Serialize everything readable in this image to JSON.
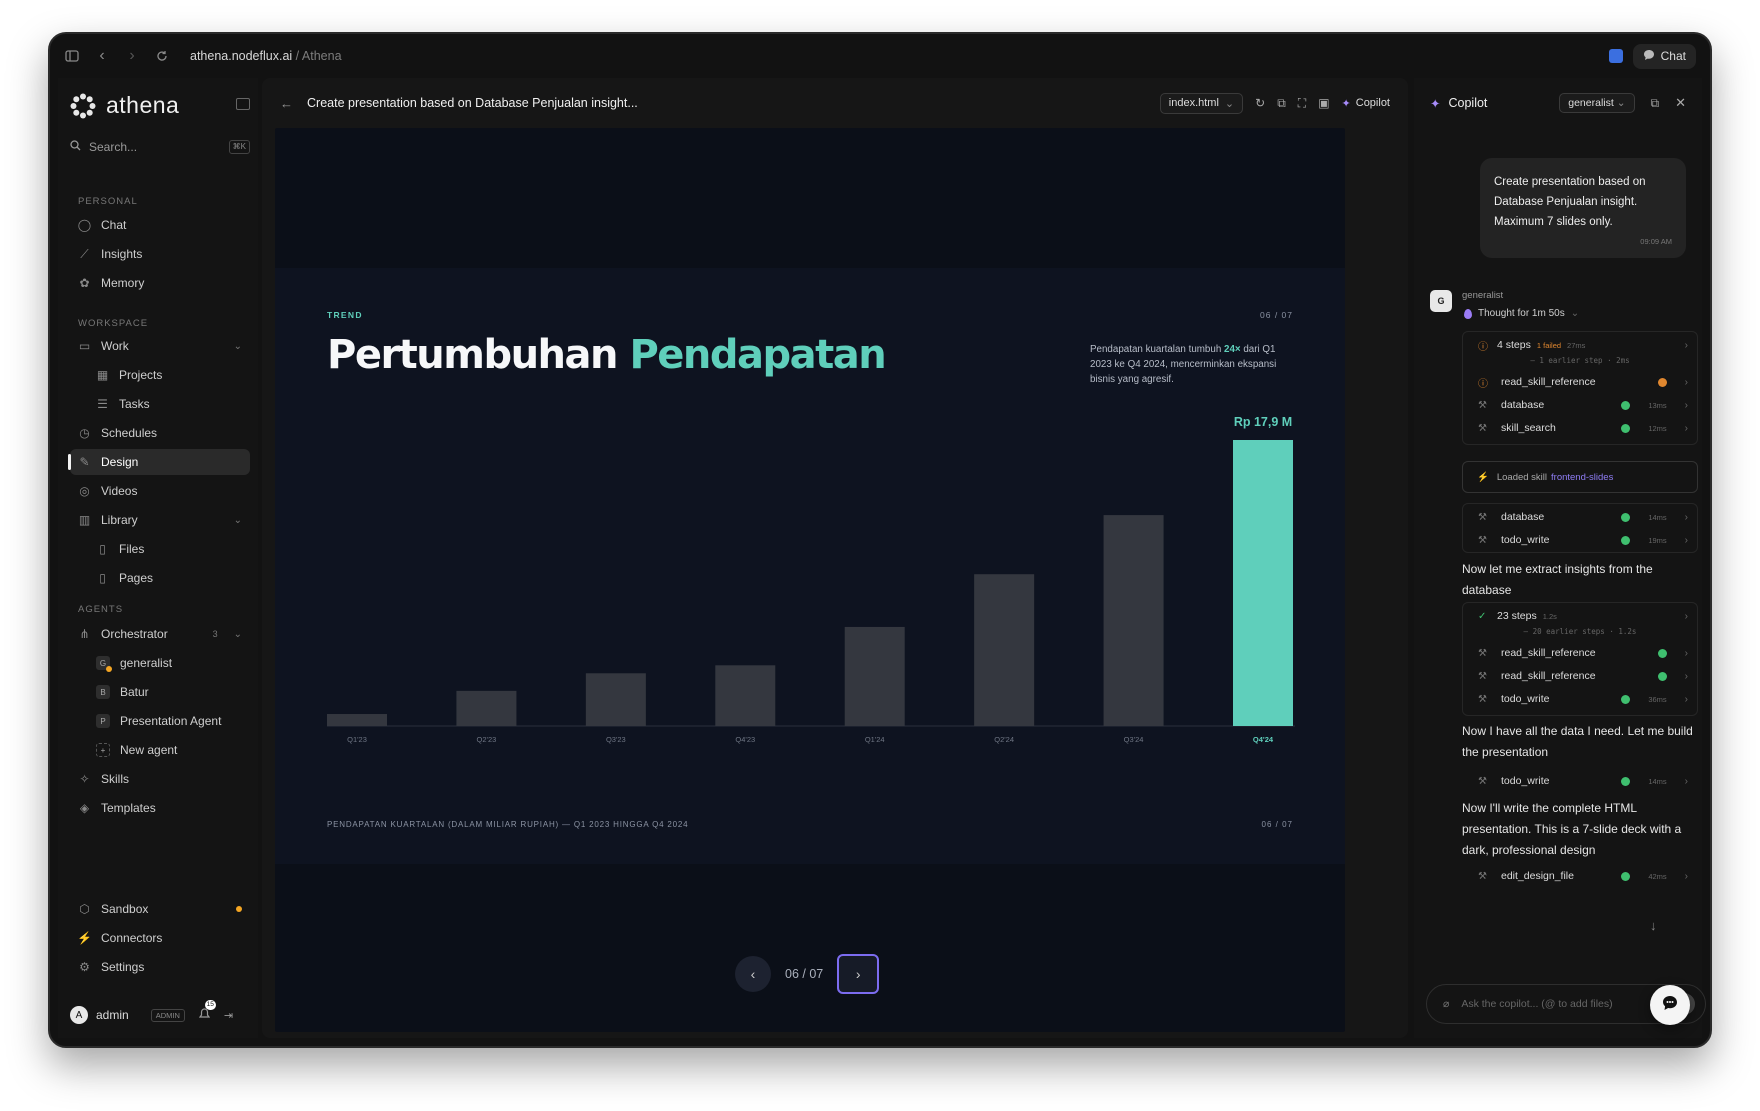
{
  "browser": {
    "url_host": "athena.nodeflux.ai",
    "url_sep": " / ",
    "url_page": "Athena",
    "chat_label": "Chat"
  },
  "sidebar": {
    "brand": "athena",
    "search_label": "Search...",
    "search_kbd": "⌘K",
    "personal_label": "PERSONAL",
    "personal": [
      "Chat",
      "Insights",
      "Memory"
    ],
    "workspace_label": "WORKSPACE",
    "work": "Work",
    "work_children": [
      "Projects",
      "Tasks"
    ],
    "schedules": "Schedules",
    "design": "Design",
    "videos": "Videos",
    "library": "Library",
    "library_children": [
      "Files",
      "Pages"
    ],
    "agents_label": "AGENTS",
    "orchestrator": "Orchestrator",
    "orchestrator_count": "3",
    "agents": [
      {
        "initial": "G",
        "name": "generalist"
      },
      {
        "initial": "B",
        "name": "Batur"
      },
      {
        "initial": "P",
        "name": "Presentation Agent"
      },
      {
        "initial": "+",
        "name": "New agent"
      }
    ],
    "skills": "Skills",
    "templates": "Templates",
    "sandbox": "Sandbox",
    "connectors": "Connectors",
    "settings": "Settings",
    "user": "admin",
    "role_badge": "ADMIN",
    "notif_count": "15",
    "user_initial": "A"
  },
  "main": {
    "title": "Create presentation based on Database Penjualan insight...",
    "file": "index.html",
    "copilot_label": "Copilot",
    "pager": "06 / 07"
  },
  "slide": {
    "kicker": "TREND",
    "page": "06 / 07",
    "title_a": "Pertumbuhan ",
    "title_b": "Pendapatan",
    "desc_a": "Pendapatan kuartalan tumbuh ",
    "desc_b": "24×",
    "desc_c": " dari Q1 2023 ke Q4 2024, mencerminkan ekspansi bisnis yang agresif.",
    "caption": "PENDAPATAN KUARTALAN (DALAM MILIAR RUPIAH) — Q1 2023 HINGGA Q4 2024",
    "caption_page": "06 / 07"
  },
  "chart_data": {
    "type": "bar",
    "categories": [
      "Q1'23",
      "Q2'23",
      "Q3'23",
      "Q4'23",
      "Q1'24",
      "Q2'24",
      "Q3'24",
      "Q4'24"
    ],
    "values": [
      0.75,
      2.2,
      3.3,
      3.8,
      6.2,
      9.5,
      13.2,
      17.9
    ],
    "highlight_index": 7,
    "highlight_label": "Rp 17,9 M",
    "ylim": [
      0,
      17.9
    ],
    "colors": {
      "bar": "#34373f",
      "highlight": "#5fcfbb"
    }
  },
  "copilot": {
    "title": "Copilot",
    "agent_select": "generalist",
    "user_message": "Create presentation based on Database Penjualan insight. Maximum 7 slides only.",
    "user_time": "09:09 AM",
    "agent_initial": "G",
    "agent_name": "generalist",
    "thought": "Thought for 1m 50s",
    "group1": {
      "label": "4 steps",
      "failed": "1 failed",
      "time": "27ms",
      "earlier": "— 1 earlier step · 2ms"
    },
    "group1_rows": [
      {
        "name": "read_skill_reference",
        "status": "warn",
        "time": ""
      },
      {
        "name": "database",
        "status": "ok",
        "time": "13ms"
      },
      {
        "name": "skill_search",
        "status": "ok",
        "time": "12ms"
      }
    ],
    "loaded_prefix": "Loaded skill",
    "loaded_skill": "frontend-slides",
    "rows2": [
      {
        "name": "database",
        "time": "14ms"
      },
      {
        "name": "todo_write",
        "time": "19ms"
      }
    ],
    "msg1": "Now let me extract insights from the database",
    "group2": {
      "label": "23 steps",
      "time": "1.2s",
      "earlier": "— 20 earlier steps · 1.2s"
    },
    "group2_rows": [
      {
        "name": "read_skill_reference",
        "time": ""
      },
      {
        "name": "read_skill_reference",
        "time": ""
      },
      {
        "name": "todo_write",
        "time": "36ms"
      }
    ],
    "msg2": "Now I have all the data I need. Let me build the presentation",
    "row3": {
      "name": "todo_write",
      "time": "14ms"
    },
    "msg3": "Now I'll write the complete HTML presentation. This is a 7-slide deck with a dark, professional design",
    "row4": {
      "name": "edit_design_file",
      "time": "42ms"
    },
    "input_placeholder": "Ask the copilot... (@ to add files)"
  }
}
